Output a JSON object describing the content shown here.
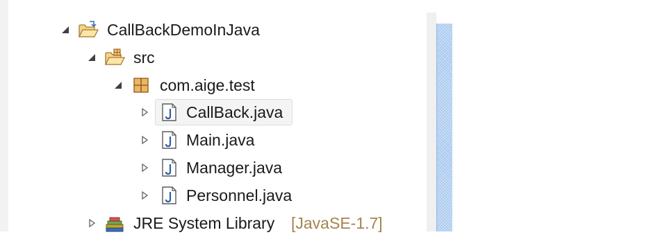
{
  "tree": {
    "project": {
      "label": "CallBackDemoInJava",
      "icon": "java-project-folder-icon",
      "expanded": true
    },
    "src": {
      "label": "src",
      "icon": "source-folder-icon",
      "expanded": true
    },
    "package": {
      "label": "com.aige.test",
      "icon": "package-icon",
      "expanded": true
    },
    "files": [
      {
        "label": "CallBack.java",
        "icon": "java-file-icon",
        "expanded": false
      },
      {
        "label": "Main.java",
        "icon": "java-file-icon",
        "expanded": false
      },
      {
        "label": "Manager.java",
        "icon": "java-file-icon",
        "expanded": false
      },
      {
        "label": "Personnel.java",
        "icon": "java-file-icon",
        "expanded": false
      }
    ],
    "jre": {
      "label": "JRE System Library",
      "decoration": "[JavaSE-1.7]",
      "icon": "library-icon",
      "expanded": false
    }
  },
  "colors": {
    "selection": "#f4f4f4",
    "decoration": "#a5834f",
    "scroll_indicator": "#a6c8ee"
  }
}
